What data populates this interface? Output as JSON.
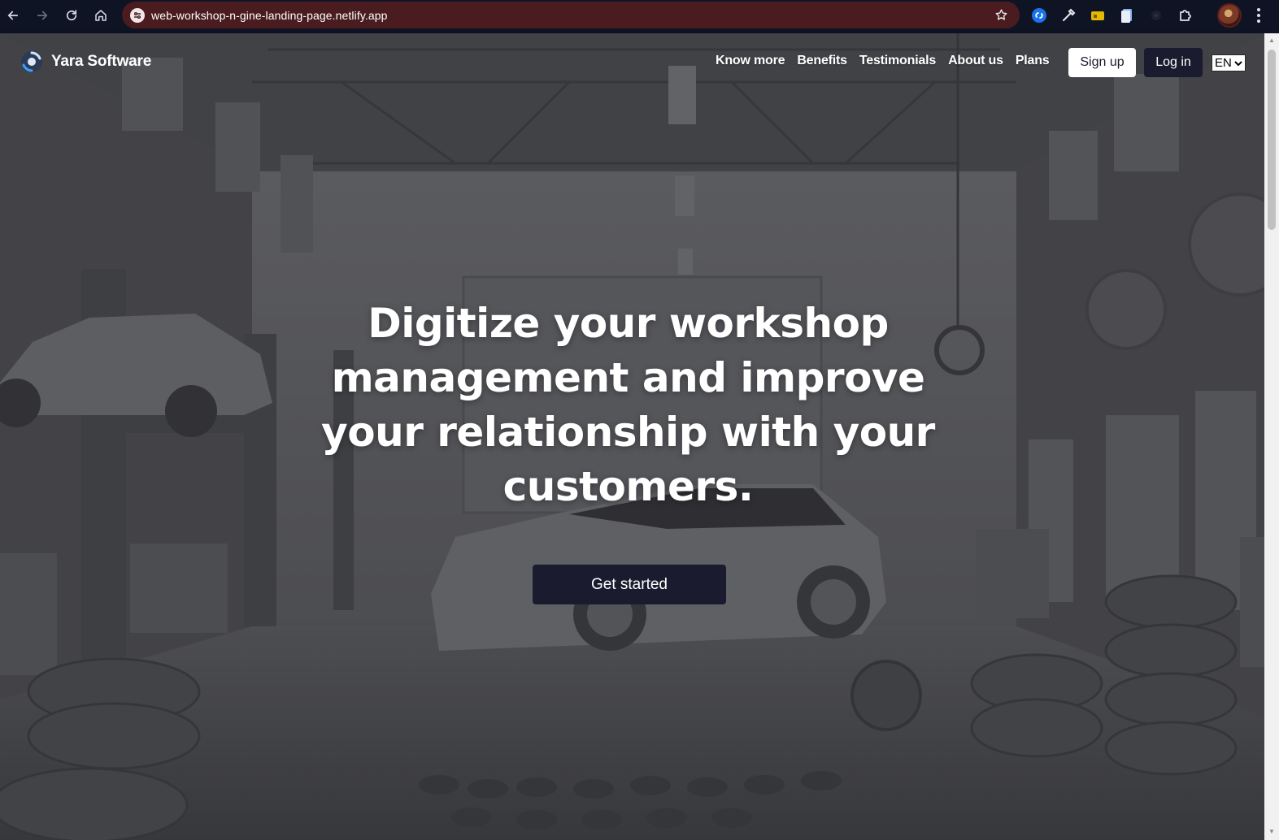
{
  "browser": {
    "url": "web-workshop-n-gine-landing-page.netlify.app",
    "omnibox_color": "#4a1c20",
    "chrome_color": "#0f1424",
    "icons": [
      "back-icon",
      "forward-icon",
      "reload-icon",
      "home-icon",
      "site-info-icon",
      "bookmark-star-icon",
      "extension-icons",
      "profile-avatar",
      "menu-icon"
    ]
  },
  "site": {
    "brand": "Yara Software",
    "nav": {
      "links": [
        "Know more",
        "Benefits",
        "Testimonials",
        "About us",
        "Plans"
      ],
      "signup_label": "Sign up",
      "login_label": "Log in",
      "language": "EN"
    },
    "hero": {
      "title": "Digitize your workshop management and improve your relationship with your customers.",
      "cta_label": "Get started"
    },
    "colors": {
      "dark_button": "#1a1b2e",
      "text_light": "#ffffff"
    }
  }
}
